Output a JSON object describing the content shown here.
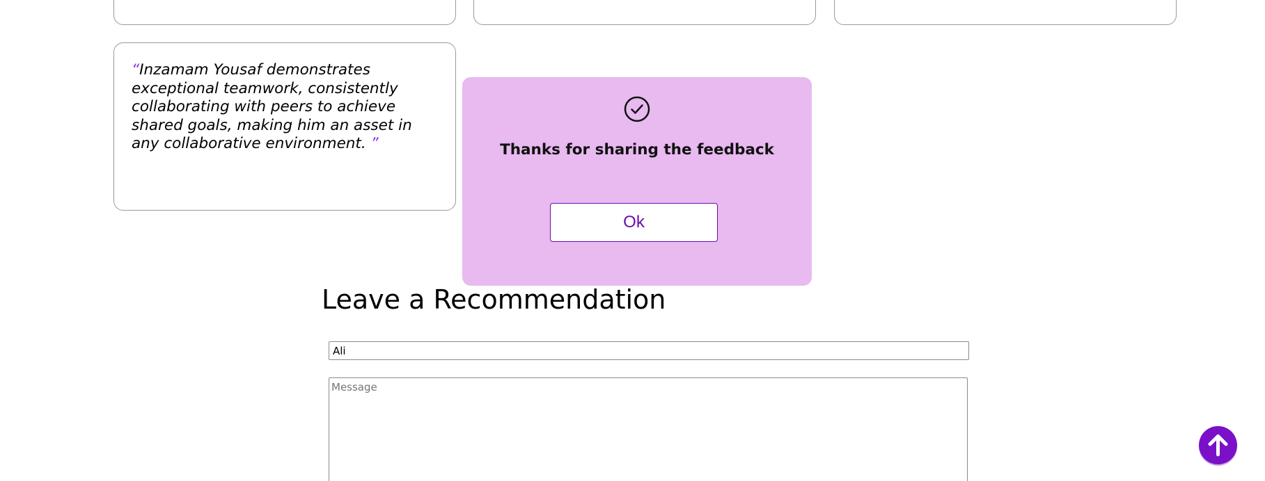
{
  "recommendations": [
    {
      "quote_open": "“",
      "text": "Inzamam Yousaf demonstrates exceptional teamwork, consistently collaborating with peers to achieve shared goals, making him an asset in any collaborative environment. ",
      "quote_close": "”"
    }
  ],
  "modal": {
    "icon": "check-circle-icon",
    "message": "Thanks for sharing the feedback",
    "ok_label": "Ok",
    "background_color": "#e8baf0"
  },
  "form": {
    "heading": "Leave a Recommendation",
    "name_value": "Ali",
    "message_placeholder": "Message"
  },
  "scroll_top": {
    "icon": "arrow-up-icon",
    "color": "#7a10c8"
  },
  "colors": {
    "accent": "#6a0dad",
    "quote_mark": "#8a2be2"
  }
}
